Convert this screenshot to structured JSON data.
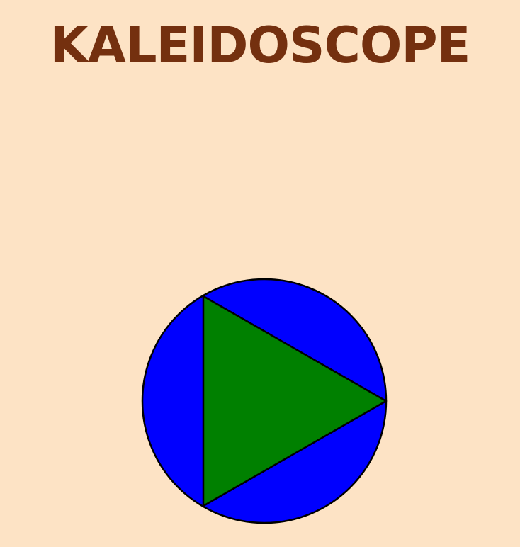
{
  "header": {
    "title": "KALEIDOSCOPE"
  },
  "play_control": {
    "icon": "play-icon",
    "circle_color": "#0000ff",
    "triangle_color": "#008000",
    "outline_color": "#000000"
  },
  "colors": {
    "background": "#fde3c5",
    "title": "#74300f"
  }
}
